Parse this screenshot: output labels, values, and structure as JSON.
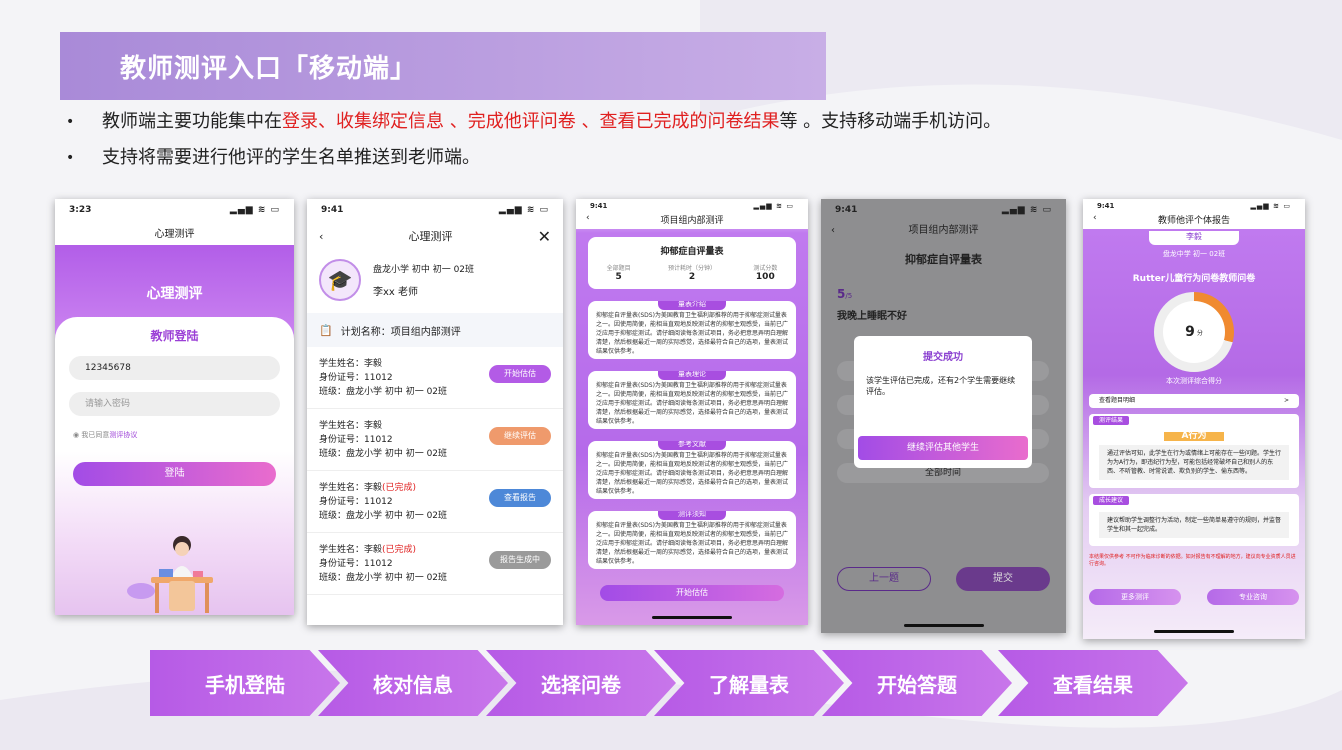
{
  "slide": {
    "title": "教师测评入口「移动端」",
    "bullets": [
      {
        "parts": [
          {
            "t": "教师端主要功能集中在",
            "red": false
          },
          {
            "t": "登录、收集绑定信息 、完成他评问卷 、查看已完成的问卷结果",
            "red": true
          },
          {
            "t": "等 。支持移动端手机访问。",
            "red": false
          }
        ]
      },
      {
        "parts": [
          {
            "t": "支持将需要进行他评的学生名单推送到老师端。",
            "red": false
          }
        ]
      }
    ],
    "bullet_symbol": "•"
  },
  "phone1": {
    "time": "3:23",
    "icons": "▂▄▆ ≋ ▭",
    "nav_title": "心理测评",
    "hero_title": "心理测评",
    "card_title": "教师登陆",
    "account_value": "12345678",
    "password_placeholder": "请输入密码",
    "agree_text": "我已同意",
    "agree_link": "测评协议",
    "login_label": "登陆"
  },
  "phone2": {
    "time": "9:41",
    "icons": "▂▄▆ ≋ ▭",
    "back": "‹",
    "nav_title": "心理测评",
    "close": "✕",
    "school": "盘龙小学 初中 初一 02班",
    "teacher": "李xx 老师",
    "plan_label": "计划名称：项目组内部测评",
    "students": [
      {
        "name": "学生姓名：李毅",
        "status": "",
        "id": "身份证号：11012",
        "class": "班级：盘龙小学 初中 初一 02班",
        "btn": "开始估估"
      },
      {
        "name": "学生姓名：李毅",
        "status": "",
        "id": "身份证号：11012",
        "class": "班级：盘龙小学 初中 初一 02班",
        "btn": "继续评估"
      },
      {
        "name": "学生姓名：李毅",
        "status": "(已完成)",
        "id": "身份证号：11012",
        "class": "班级：盘龙小学 初中 初一 02班",
        "btn": "查看报告"
      },
      {
        "name": "学生姓名：李毅",
        "status": "(已完成)",
        "id": "身份证号：11012",
        "class": "班级：盘龙小学 初中 初一 02班",
        "btn": "报告生成中"
      }
    ]
  },
  "phone3": {
    "time": "9:41",
    "icons": "▂▄▆ ≋ ▭",
    "back": "‹",
    "nav_title": "项目组内部测评",
    "scale_title": "抑郁症自评量表",
    "stats": [
      {
        "label": "全部题目",
        "value": "5"
      },
      {
        "label": "预计耗时（分钟）",
        "value": "2"
      },
      {
        "label": "测试分数",
        "value": "100"
      }
    ],
    "sections": [
      {
        "tag": "量表介绍",
        "text": "抑郁症自评量表(SDS)为美国教育卫生福利部推荐的用于抑郁症测试量表之一。因使用简便，能相当直观地反映测试者的抑郁主观感受，当前已广泛应用于抑郁症测试。请仔细阅读每条测试项目，务必把意思弄明白理解清楚，然后根据最近一周的实际感觉，选择最符合自己的选项，量表测试结果仅供参考。"
      },
      {
        "tag": "量表理论",
        "text": "抑郁症自评量表(SDS)为美国教育卫生福利部推荐的用于抑郁症测试量表之一。因使用简便，能相当直观地反映测试者的抑郁主观感受，当前已广泛应用于抑郁症测试。请仔细阅读每条测试项目，务必把意思弄明白理解清楚，然后根据最近一周的实际感觉，选择最符合自己的选项，量表测试结果仅供参考。"
      },
      {
        "tag": "参考文献",
        "text": "抑郁症自评量表(SDS)为美国教育卫生福利部推荐的用于抑郁症测试量表之一。因使用简便，能相当直观地反映测试者的抑郁主观感受，当前已广泛应用于抑郁症测试。请仔细阅读每条测试项目，务必把意思弄明白理解清楚，然后根据最近一周的实际感觉，选择最符合自己的选项，量表测试结果仅供参考。"
      },
      {
        "tag": "测评须知",
        "text": "抑郁症自评量表(SDS)为美国教育卫生福利部推荐的用于抑郁症测试量表之一。因使用简便，能相当直观地反映测试者的抑郁主观感受，当前已广泛应用于抑郁症测试。请仔细阅读每条测试项目，务必把意思弄明白理解清楚，然后根据最近一周的实际感觉，选择最符合自己的选项，量表测试结果仅供参考。"
      }
    ],
    "start_label": "开始估估"
  },
  "phone4": {
    "time": "9:41",
    "icons": "▂▄▆ ≋ ▭",
    "back": "‹",
    "nav_title": "项目组内部测评",
    "scale_title": "抑郁症自评量表",
    "q_num": "5",
    "q_total": "/5",
    "question": "我晚上睡眠不好",
    "option_last": "全部时间",
    "modal_title": "提交成功",
    "modal_text": "该学生评估已完成，还有2个学生需要继续评估。",
    "modal_btn": "继续评估其他学生",
    "prev_label": "上一题",
    "submit_label": "提交"
  },
  "phone5": {
    "time": "9:41",
    "icons": "▂▄▆ ≋ ▭",
    "back": "‹",
    "nav_title": "教师他评个体报告",
    "student": "李毅",
    "school": "盘龙中学  初一  02班",
    "questionnaire": "Rutter儿童行为问卷教师问卷",
    "score": "9",
    "score_unit": "分",
    "score_label": "本次测评综合得分",
    "detail_row": "查看题目明细",
    "detail_arrow": ">",
    "result_label": "测评结果",
    "badge": "A行为",
    "result_text": "通过评估可知，此学生在行为或情绪上可能存在一些问题。学生行为为A行为，即违纪行为型，可能包括经常破坏自己和别人的东西、不听管教、时常说谎、欺负别的学生、偷东西等。",
    "advice_label": "成长建议",
    "advice_text": "建议帮助学生调整行为活动，制定一些简单易遵守的规则，并监督学生和其一起完成。",
    "warn": "本结果仅供参考 不可作为临床诊断的依据。如对报告有不理解的地方，建议向专业资质人员进行咨询。",
    "btn_more": "更多测评",
    "btn_consult": "专业咨询"
  },
  "flow": [
    "手机登陆",
    "核对信息",
    "选择问卷",
    "了解量表",
    "开始答题",
    "查看结果"
  ],
  "colors": {
    "accent": "#b25ee8",
    "red": "#e02020",
    "title_bar": "#a98ad8"
  }
}
